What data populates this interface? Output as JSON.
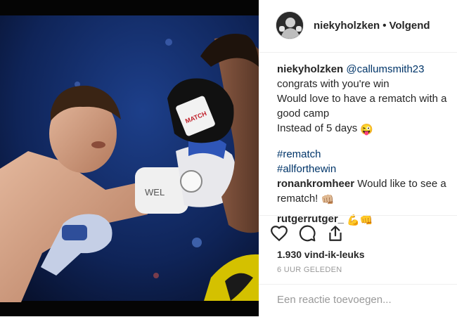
{
  "post": {
    "username": "niekyholzken",
    "separator": "•",
    "follow_status": "Volgend",
    "photo_alt": "boxing-match-photo"
  },
  "caption": {
    "username": "niekyholzken",
    "mention": "@callumsmith23",
    "lines": [
      "congrats with you're win",
      "Would love to have a rematch with a",
      "good camp",
      "Instead of 5 days"
    ],
    "emoji": "😜",
    "hashtags": [
      "#rematch",
      "#allforthewin"
    ]
  },
  "comments": [
    {
      "username": "ronankromheer",
      "text_line1": "Would like to see a",
      "text_line2": "rematch!",
      "emoji": "👊🏼"
    },
    {
      "username": "rutgerrutger_",
      "text": "",
      "emoji": "💪👊"
    }
  ],
  "actions": {
    "like_icon": "heart-icon",
    "comment_icon": "comment-icon",
    "share_icon": "share-icon"
  },
  "likes": "1.930 vind-ik-leuks",
  "time": "6 UUR GELEDEN",
  "add_comment": {
    "placeholder": "Een reactie toevoegen..."
  }
}
